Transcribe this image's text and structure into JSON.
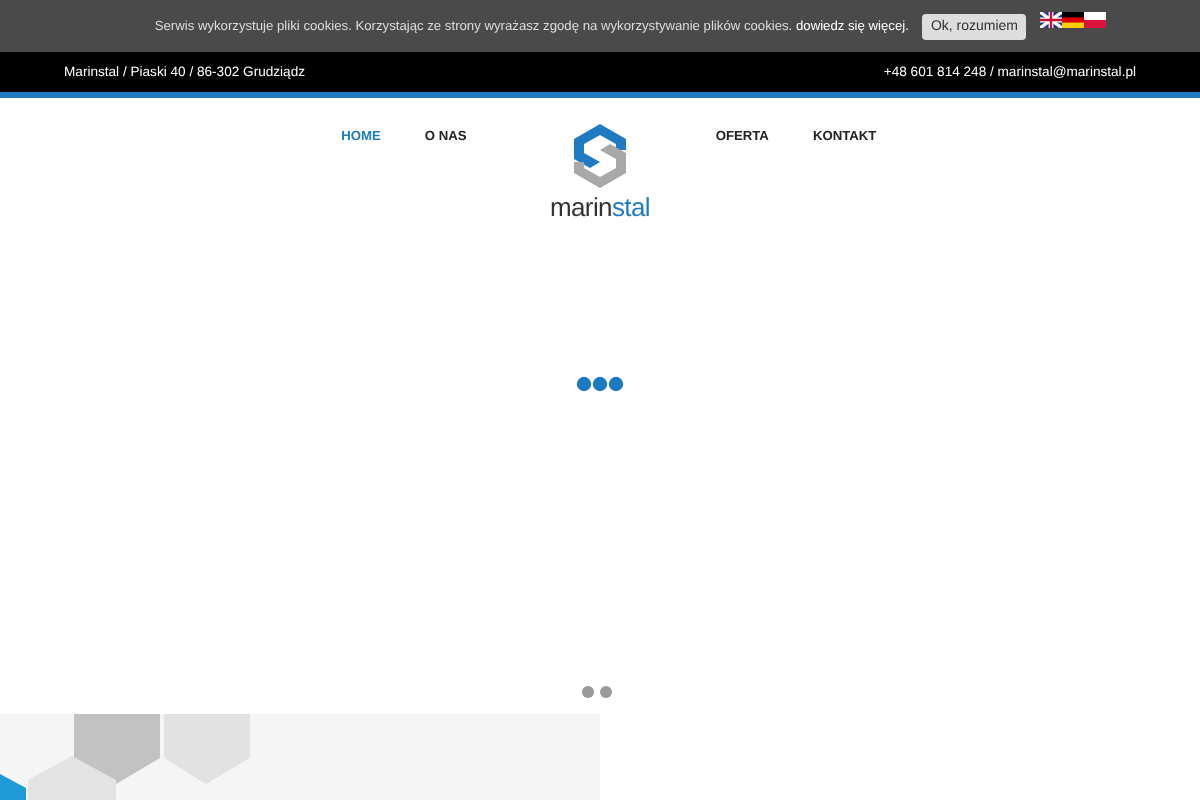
{
  "cookie_bar": {
    "message": "Serwis wykorzystuje pliki cookies. Korzystając ze strony wyrażasz zgodę na wykorzystywanie plików cookies.",
    "link": "dowiedz się więcej.",
    "button": "Ok, rozumiem"
  },
  "top_bar": {
    "address": "Marinstal / Piaski 40 / 86-302 Grudziądz",
    "contact": "+48 601 814 248 / marinstal@marinstal.pl"
  },
  "nav": [
    {
      "label": "HOME",
      "selected": true
    },
    {
      "label": "O NAS",
      "selected": false
    },
    {
      "label": "OFERTA",
      "selected": false
    },
    {
      "label": "KONTAKT",
      "selected": false
    }
  ],
  "logo": {
    "dark": "marin",
    "accent": "stal"
  },
  "slider": {
    "dots": [
      {
        "selected": false
      },
      {
        "selected": false
      }
    ]
  }
}
